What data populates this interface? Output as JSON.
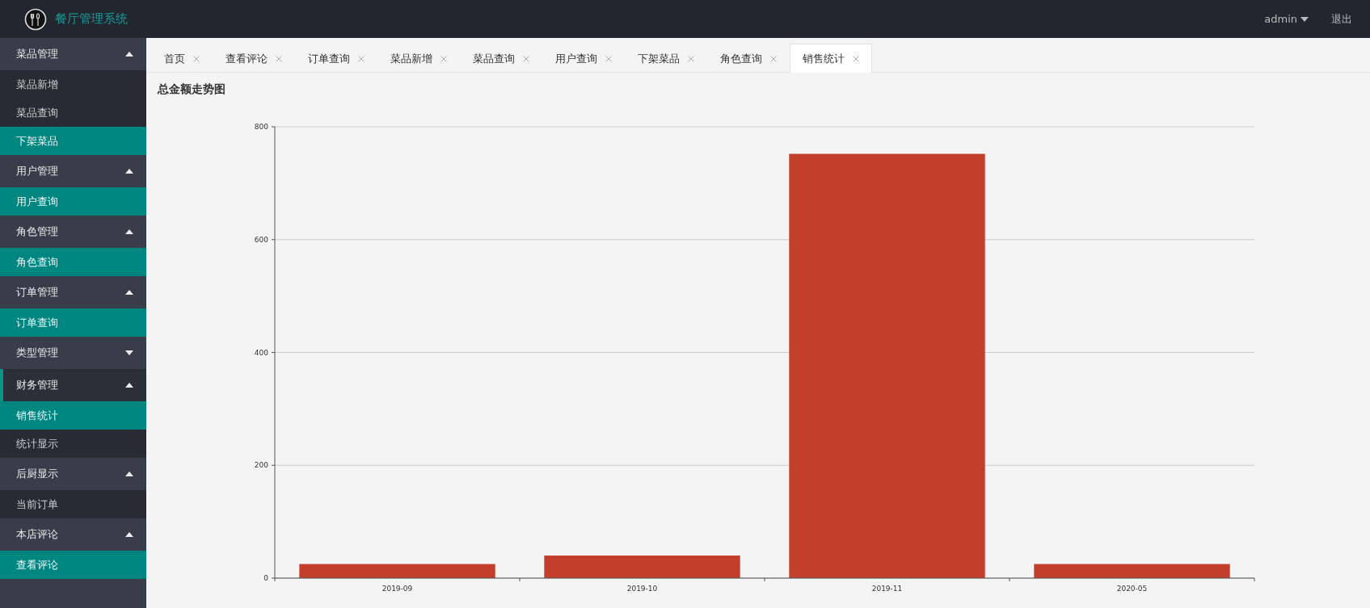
{
  "header": {
    "title": "餐厅管理系统",
    "user": "admin",
    "logout": "退出"
  },
  "sidebar": {
    "groups": [
      {
        "label": "菜品管理",
        "expanded": true,
        "active": false,
        "items": [
          {
            "label": "菜品新增",
            "highlighted": false
          },
          {
            "label": "菜品查询",
            "highlighted": false
          },
          {
            "label": "下架菜品",
            "highlighted": true
          }
        ]
      },
      {
        "label": "用户管理",
        "expanded": true,
        "active": false,
        "items": [
          {
            "label": "用户查询",
            "highlighted": true
          }
        ]
      },
      {
        "label": "角色管理",
        "expanded": true,
        "active": false,
        "items": [
          {
            "label": "角色查询",
            "highlighted": true
          }
        ]
      },
      {
        "label": "订单管理",
        "expanded": true,
        "active": false,
        "items": [
          {
            "label": "订单查询",
            "highlighted": true
          }
        ]
      },
      {
        "label": "类型管理",
        "expanded": false,
        "active": false
      },
      {
        "label": "财务管理",
        "expanded": true,
        "active": true,
        "items": [
          {
            "label": "销售统计",
            "highlighted": true
          },
          {
            "label": "统计显示",
            "highlighted": false
          }
        ]
      },
      {
        "label": "后厨显示",
        "expanded": true,
        "active": false,
        "items": [
          {
            "label": "当前订单",
            "highlighted": false
          }
        ]
      },
      {
        "label": "本店评论",
        "expanded": true,
        "active": false,
        "items": [
          {
            "label": "查看评论",
            "highlighted": true
          }
        ]
      }
    ]
  },
  "tabs": [
    {
      "label": "首页",
      "selected": false
    },
    {
      "label": "查看评论",
      "selected": false
    },
    {
      "label": "订单查询",
      "selected": false
    },
    {
      "label": "菜品新增",
      "selected": false
    },
    {
      "label": "菜品查询",
      "selected": false
    },
    {
      "label": "用户查询",
      "selected": false
    },
    {
      "label": "下架菜品",
      "selected": false
    },
    {
      "label": "角色查询",
      "selected": false
    },
    {
      "label": "销售统计",
      "selected": true
    }
  ],
  "chart": {
    "chart_data": {
      "type": "bar",
      "title": "总金额走势图",
      "categories": [
        "2019-09",
        "2019-10",
        "2019-11",
        "2020-05"
      ],
      "series": [
        {
          "color": "#c23f2c",
          "values": [
            25,
            40,
            752,
            25
          ]
        }
      ],
      "grid": true,
      "ylim": [
        0,
        800
      ],
      "yticks": [
        0,
        200,
        400,
        600,
        800
      ]
    }
  }
}
